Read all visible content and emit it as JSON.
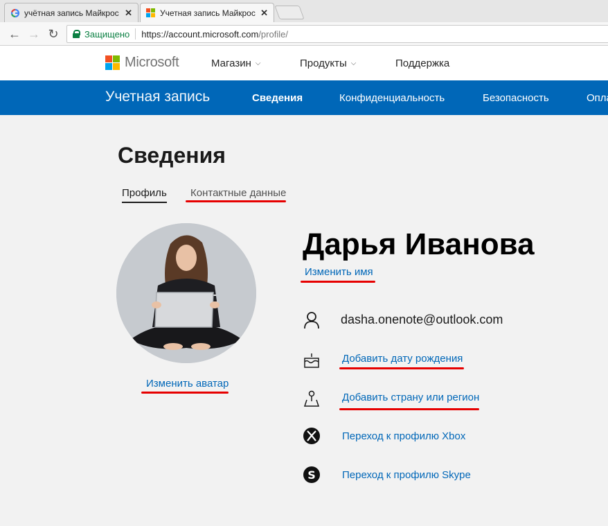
{
  "browser": {
    "tabs": [
      {
        "title": "учётная запись Майкрос",
        "active": false,
        "favicon": "google-icon"
      },
      {
        "title": "Учетная запись Майкрос",
        "active": true,
        "favicon": "microsoft-icon"
      }
    ],
    "address": {
      "secure_label": "Защищено",
      "host": "https://account.microsoft.com",
      "path": "/profile/"
    }
  },
  "ms_header": {
    "wordmark": "Microsoft",
    "nav": [
      "Магазин",
      "Продукты",
      "Поддержка"
    ],
    "logo_colors": [
      "#f25022",
      "#7fba00",
      "#00a4ef",
      "#ffb900"
    ]
  },
  "account_bar": {
    "brand": "Учетная запись",
    "nav": [
      {
        "label": "Сведения",
        "active": true
      },
      {
        "label": "Конфиденциальность",
        "active": false
      },
      {
        "label": "Безопасность",
        "active": false
      },
      {
        "label": "Опла",
        "active": false
      }
    ],
    "color": "#0067b8"
  },
  "page": {
    "title": "Сведения",
    "tabs": [
      {
        "label": "Профиль",
        "active": true
      },
      {
        "label": "Контактные данные",
        "active": false
      }
    ]
  },
  "profile": {
    "change_avatar": "Изменить аватар",
    "name": "Дарья Иванова",
    "change_name": "Изменить имя",
    "email": "dasha.onenote@outlook.com",
    "items": [
      {
        "icon": "birthday-cake-icon",
        "label": "Добавить дату рождения"
      },
      {
        "icon": "location-pin-icon",
        "label": "Добавить страну или регион"
      },
      {
        "icon": "xbox-icon",
        "label": "Переход к профилю Xbox"
      },
      {
        "icon": "skype-icon",
        "label": "Переход к профилю Skype"
      }
    ]
  },
  "annotation_color": "#e60000"
}
